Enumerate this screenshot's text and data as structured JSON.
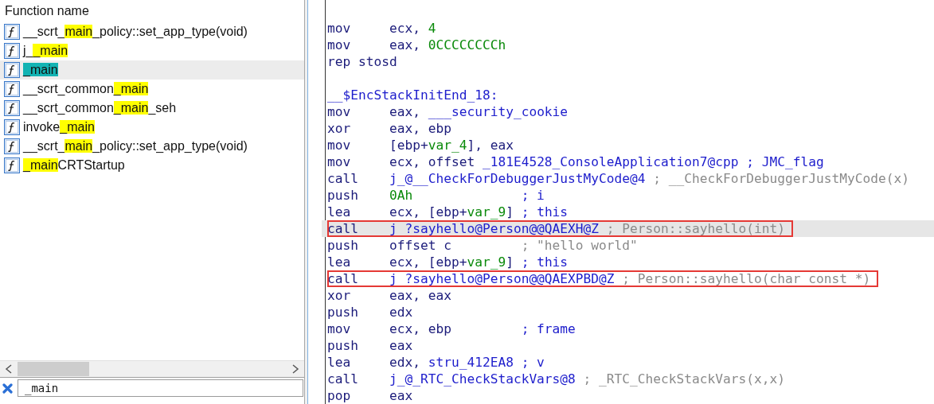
{
  "functions": {
    "header": "Function name",
    "items": [
      {
        "before": "__scrt_",
        "match": "main",
        "after": "_policy::set_app_type(void)",
        "selected": false
      },
      {
        "before": "j_",
        "match": "_main",
        "selected": false
      },
      {
        "match": "_main",
        "selected": true
      },
      {
        "before": "__scrt_common",
        "match": "_main",
        "selected": false
      },
      {
        "before": "__scrt_common",
        "match": "_main",
        "after": "_seh",
        "selected": false
      },
      {
        "before": "invoke",
        "match": "_main",
        "selected": false
      },
      {
        "before": "__scrt_",
        "match": "main",
        "after": "_policy::set_app_type(void)",
        "selected": false
      },
      {
        "match": "_main",
        "after": "CRTStartup",
        "selected": false
      }
    ],
    "filter": {
      "value": "_main"
    }
  },
  "disassembly": [
    {
      "kind": "instruction",
      "mnemonic": "mov",
      "operands": [
        {
          "text": "ecx, ",
          "kind": "reg"
        },
        {
          "text": "4",
          "kind": "num"
        }
      ],
      "selected": false,
      "boxed": false
    },
    {
      "kind": "instruction",
      "mnemonic": "mov",
      "operands": [
        {
          "text": "eax, ",
          "kind": "reg"
        },
        {
          "text": "0CCCCCCCCh",
          "kind": "num"
        }
      ],
      "selected": false,
      "boxed": false
    },
    {
      "kind": "instruction",
      "mnemonic": "rep stosd",
      "selected": false,
      "boxed": false
    },
    {
      "kind": "blank",
      "selected": false,
      "boxed": false
    },
    {
      "kind": "label",
      "text": "__$EncStackInitEnd_18:",
      "selected": false,
      "boxed": false
    },
    {
      "kind": "instruction",
      "mnemonic": "mov",
      "operands": [
        {
          "text": "eax, ",
          "kind": "reg"
        },
        {
          "text": "___security_cookie",
          "kind": "name"
        }
      ],
      "selected": false,
      "boxed": false
    },
    {
      "kind": "instruction",
      "mnemonic": "xor",
      "operands": [
        {
          "text": "eax, ebp",
          "kind": "reg"
        }
      ],
      "selected": false,
      "boxed": false
    },
    {
      "kind": "instruction",
      "mnemonic": "mov",
      "operands": [
        {
          "text": "[ebp+",
          "kind": "reg"
        },
        {
          "text": "var_4",
          "kind": "num"
        },
        {
          "text": "], eax",
          "kind": "reg"
        }
      ],
      "selected": false,
      "boxed": false
    },
    {
      "kind": "instruction",
      "mnemonic": "mov",
      "operands": [
        {
          "text": "ecx, offset ",
          "kind": "reg"
        },
        {
          "text": "_181E4528_ConsoleApplication7@cpp",
          "kind": "name"
        }
      ],
      "comment": {
        "text": "; JMC_flag",
        "kind": "user"
      },
      "selected": false,
      "boxed": false
    },
    {
      "kind": "instruction",
      "mnemonic": "call",
      "operands": [
        {
          "text": "j_@__CheckForDebuggerJustMyCode@4",
          "kind": "name"
        }
      ],
      "comment": {
        "text": "; __CheckForDebuggerJustMyCode(x)",
        "kind": "auto"
      },
      "selected": false,
      "boxed": false
    },
    {
      "kind": "instruction",
      "mnemonic": "push",
      "operands": [
        {
          "text": "0Ah             ",
          "kind": "num"
        }
      ],
      "comment": {
        "text": "; i",
        "kind": "user"
      },
      "selected": false,
      "boxed": false
    },
    {
      "kind": "instruction",
      "mnemonic": "lea",
      "operands": [
        {
          "text": "ecx, [ebp+",
          "kind": "reg"
        },
        {
          "text": "var_9",
          "kind": "num"
        },
        {
          "text": "]",
          "kind": "reg"
        }
      ],
      "comment": {
        "text": "; this",
        "kind": "user"
      },
      "selected": false,
      "boxed": false
    },
    {
      "kind": "instruction",
      "mnemonic": "call",
      "operands": [
        {
          "text": "j_?sayhello@Person@@QAEXH@Z",
          "kind": "name"
        }
      ],
      "comment": {
        "text": "; Person::sayhello(int)",
        "kind": "auto"
      },
      "selected": true,
      "boxed": true
    },
    {
      "kind": "instruction",
      "mnemonic": "push",
      "operands": [
        {
          "text": "offset c        ",
          "kind": "reg"
        }
      ],
      "comment": {
        "text": "; \"hello world\"",
        "kind": "auto"
      },
      "selected": false,
      "boxed": false
    },
    {
      "kind": "instruction",
      "mnemonic": "lea",
      "operands": [
        {
          "text": "ecx, [ebp+",
          "kind": "reg"
        },
        {
          "text": "var_9",
          "kind": "num"
        },
        {
          "text": "]",
          "kind": "reg"
        }
      ],
      "comment": {
        "text": "; this",
        "kind": "user"
      },
      "selected": false,
      "boxed": false
    },
    {
      "kind": "instruction",
      "mnemonic": "call",
      "operands": [
        {
          "text": "j_?sayhello@Person@@QAEXPBD@Z",
          "kind": "name"
        }
      ],
      "comment": {
        "text": "; Person::sayhello(char const *)",
        "kind": "auto"
      },
      "selected": false,
      "boxed": true
    },
    {
      "kind": "instruction",
      "mnemonic": "xor",
      "operands": [
        {
          "text": "eax, eax",
          "kind": "reg"
        }
      ],
      "selected": false,
      "boxed": false
    },
    {
      "kind": "instruction",
      "mnemonic": "push",
      "operands": [
        {
          "text": "edx",
          "kind": "reg"
        }
      ],
      "selected": false,
      "boxed": false
    },
    {
      "kind": "instruction",
      "mnemonic": "mov",
      "operands": [
        {
          "text": "ecx, ebp        ",
          "kind": "reg"
        }
      ],
      "comment": {
        "text": "; frame",
        "kind": "user"
      },
      "selected": false,
      "boxed": false
    },
    {
      "kind": "instruction",
      "mnemonic": "push",
      "operands": [
        {
          "text": "eax",
          "kind": "reg"
        }
      ],
      "selected": false,
      "boxed": false
    },
    {
      "kind": "instruction",
      "mnemonic": "lea",
      "operands": [
        {
          "text": "edx, ",
          "kind": "reg"
        },
        {
          "text": "stru_412EA8",
          "kind": "name"
        }
      ],
      "comment": {
        "text": "; v",
        "kind": "user"
      },
      "selected": false,
      "boxed": false
    },
    {
      "kind": "instruction",
      "mnemonic": "call",
      "operands": [
        {
          "text": "j_@_RTC_CheckStackVars@8",
          "kind": "name"
        }
      ],
      "comment": {
        "text": "; _RTC_CheckStackVars(x,x)",
        "kind": "auto"
      },
      "selected": false,
      "boxed": false
    },
    {
      "kind": "instruction",
      "mnemonic": "pop",
      "operands": [
        {
          "text": "eax",
          "kind": "reg"
        }
      ],
      "selected": false,
      "boxed": false
    }
  ]
}
